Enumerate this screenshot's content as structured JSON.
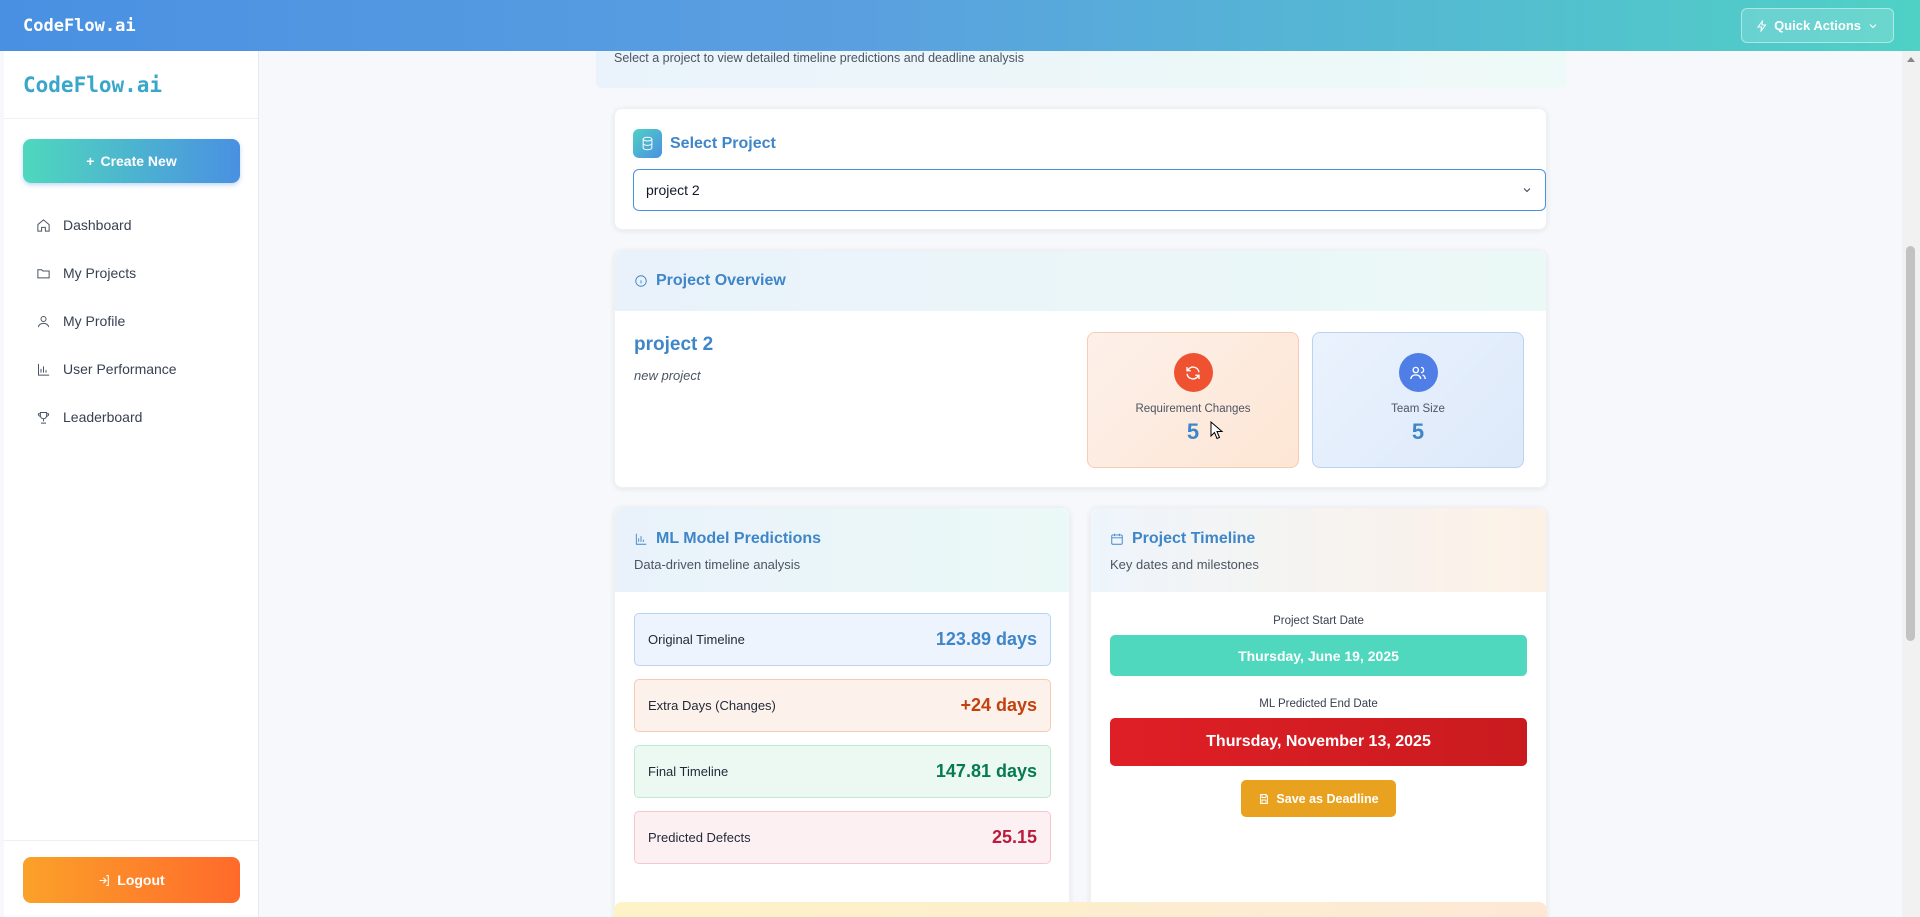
{
  "topbar": {
    "brand": "CodeFlow.ai",
    "quick_actions": "Quick Actions"
  },
  "sidebar": {
    "brand": "CodeFlow.ai",
    "create_label": "Create New",
    "items": [
      {
        "label": "Dashboard",
        "icon": "home-icon"
      },
      {
        "label": "My Projects",
        "icon": "folder-icon"
      },
      {
        "label": "My Profile",
        "icon": "user-icon"
      },
      {
        "label": "User Performance",
        "icon": "bar-chart-icon"
      },
      {
        "label": "Leaderboard",
        "icon": "trophy-icon"
      }
    ],
    "logout_label": "Logout"
  },
  "main": {
    "subtitle": "Select a project to view detailed timeline predictions and deadline analysis",
    "select_project": {
      "title": "Select Project",
      "value": "project 2"
    },
    "overview": {
      "title": "Project Overview",
      "name": "project 2",
      "description": "new project",
      "requirement_changes": {
        "label": "Requirement Changes",
        "value": "5"
      },
      "team_size": {
        "label": "Team Size",
        "value": "5"
      }
    },
    "predictions": {
      "title": "ML Model Predictions",
      "subtitle": "Data-driven timeline analysis",
      "metrics": [
        {
          "label": "Original Timeline",
          "value": "123.89 days"
        },
        {
          "label": "Extra Days (Changes)",
          "value": "+24 days"
        },
        {
          "label": "Final Timeline",
          "value": "147.81 days"
        },
        {
          "label": "Predicted Defects",
          "value": "25.15"
        }
      ]
    },
    "timeline": {
      "title": "Project Timeline",
      "subtitle": "Key dates and milestones",
      "start_label": "Project Start Date",
      "start_date": "Thursday, June 19, 2025",
      "end_label": "ML Predicted End Date",
      "end_date": "Thursday, November 13, 2025",
      "save_label": "Save as Deadline"
    }
  },
  "colors": {
    "accent": "#3f86c9",
    "teal": "#4fd8bd",
    "orange": "#ff6a2b",
    "red": "#d7191f",
    "green": "#067a52"
  }
}
